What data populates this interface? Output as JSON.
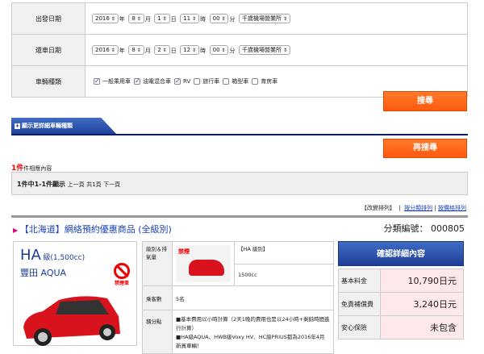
{
  "form": {
    "departure": {
      "label": "出發日期",
      "year": "2016",
      "month": "8",
      "day": "1",
      "hour": "11",
      "minute": "00",
      "office": "千歲機場營業所"
    },
    "return": {
      "label": "還車日期",
      "year": "2016",
      "month": "8",
      "day": "2",
      "hour": "12",
      "minute": "00",
      "office": "千歲機場營業所"
    },
    "units": {
      "year": "年",
      "month": "月",
      "day": "日",
      "hour": "時",
      "minute": "分"
    },
    "vehicle": {
      "label": "車輛種類",
      "options": [
        {
          "label": "一般乘用車",
          "checked": true
        },
        {
          "label": "油電混合車",
          "checked": true
        },
        {
          "label": "RV",
          "checked": true
        },
        {
          "label": "旅行車",
          "checked": false
        },
        {
          "label": "箱型車",
          "checked": false
        },
        {
          "label": "育房車",
          "checked": false
        }
      ]
    }
  },
  "search_label": "搜尋",
  "detail_tab": "顯示更詳細車輛種類",
  "research_label": "再搜尋",
  "result": {
    "count": "1件",
    "count_suffix": "件相應內容",
    "range": "1件中1-1件顯示",
    "prev": "上一頁",
    "pages": "共1頁",
    "next": "下一頁"
  },
  "sort": {
    "label": "【改變排列】",
    "sep": "|",
    "by_class": "按分類排列",
    "by_price": "按價格排列"
  },
  "product": {
    "title": "【北海道】網絡預約優惠商品 (全級別)",
    "code_label": "分類編號：",
    "code": "000805",
    "class_name": "HA",
    "class_suffix": "級(1,500cc)",
    "model": "豐田 AQUA",
    "no_smoking": "禁煙車",
    "no_smoking_small": "禁煙",
    "spec": {
      "class_label": "級別＆排氣量",
      "class_value": "【HA 級別】",
      "cc": "1500cc",
      "seats_label": "乘客數",
      "seats": "5名",
      "points_label": "積分點",
      "point1": "■基本費用以小時計算（2天1晚的費用也是以24小時+剩餘時間進行計算）",
      "point2": "■HA級AQUA、HWB級Voxy HV、HC級PRIUS都為2016年4月新買車輛！"
    },
    "confirm_label": "確認詳細內容",
    "prices": [
      {
        "label": "基本料金",
        "value": "10,790日元"
      },
      {
        "label": "免責補償費",
        "value": "3,240日元"
      },
      {
        "label": "安心保險",
        "value": "未包含"
      }
    ]
  }
}
